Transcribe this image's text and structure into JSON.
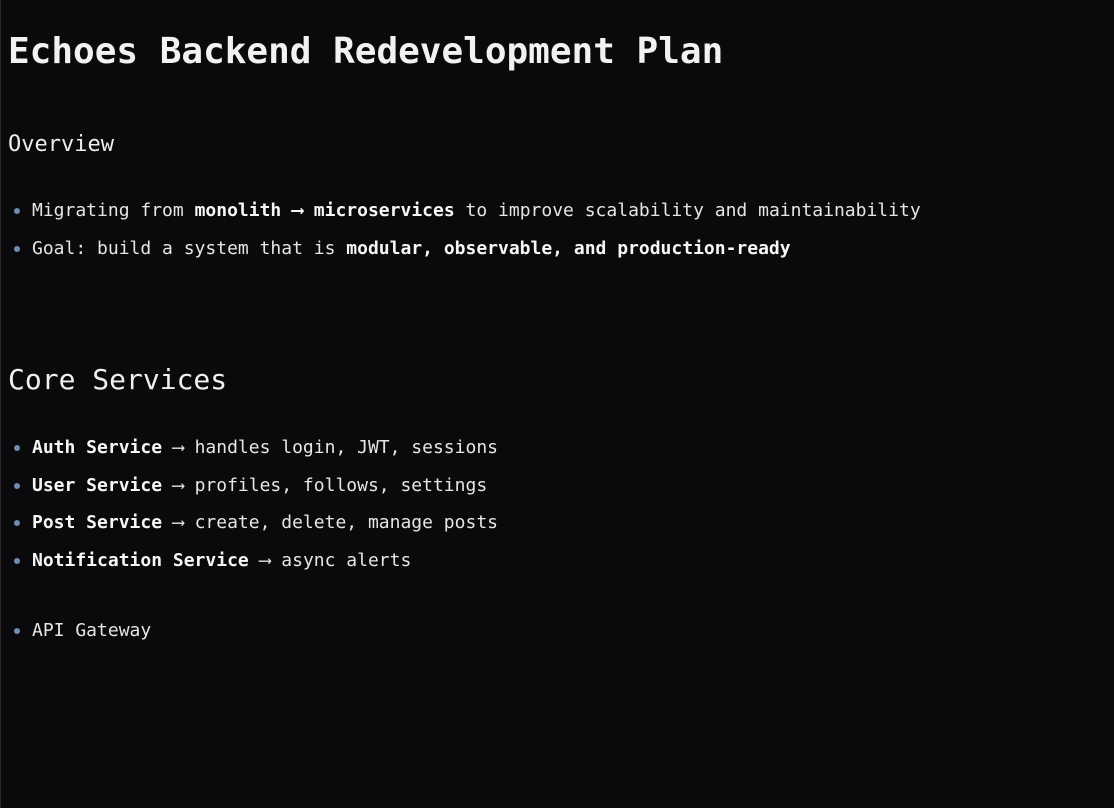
{
  "document": {
    "title": "Echoes Backend Redevelopment Plan",
    "overview": {
      "heading": "Overview",
      "items": [
        {
          "p1": "Migrating from ",
          "b1": "monolith",
          "p2": " ⟶ ",
          "b2": "microservices",
          "p3": " to improve scalability and maintainability"
        },
        {
          "p1": "Goal: build a system that is ",
          "b1": "modular, observable, and production-ready"
        }
      ]
    },
    "core_services": {
      "heading": "Core Services",
      "items": [
        {
          "name": "Auth Service",
          "arrow": " ⟶ ",
          "desc": "handles login, JWT, sessions"
        },
        {
          "name": "User Service",
          "arrow": " ⟶ ",
          "desc": "profiles, follows, settings"
        },
        {
          "name": "Post Service",
          "arrow": " ⟶ ",
          "desc": "create, delete, manage posts"
        },
        {
          "name": "Notification Service",
          "arrow": " ⟶ ",
          "desc": "async alerts"
        }
      ],
      "extra_items": [
        "API Gateway"
      ]
    }
  }
}
